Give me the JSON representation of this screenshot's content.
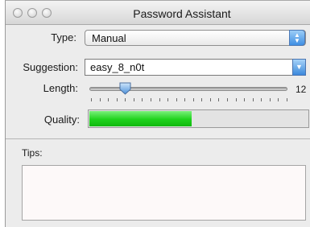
{
  "window": {
    "title": "Password Assistant"
  },
  "type_field": {
    "label": "Type:",
    "value": "Manual"
  },
  "suggestion_field": {
    "label": "Suggestion:",
    "value": "easy_8_n0t"
  },
  "length_field": {
    "label": "Length:",
    "value": "12",
    "slider_min": 8,
    "slider_max": 31,
    "slider_value": 12
  },
  "quality_field": {
    "label": "Quality:",
    "level_fraction": 0.47,
    "fill_color": "#1ed21c"
  },
  "tips": {
    "label": "Tips:",
    "text": ""
  },
  "icons": {
    "close": "close-button-icon",
    "minimize": "minimize-button-icon",
    "zoom": "zoom-button-icon",
    "popup_arrows": "up-down-arrows-icon",
    "combo_arrow": "chevron-down-icon"
  }
}
